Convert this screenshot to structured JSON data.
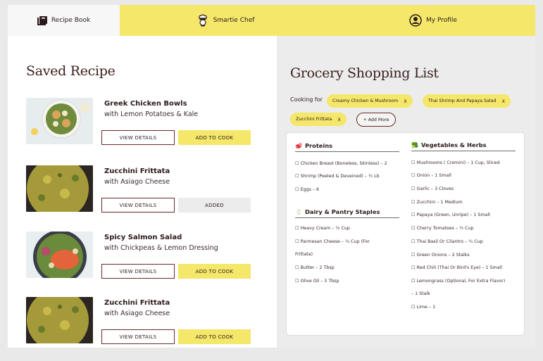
{
  "nav": {
    "tabs": [
      {
        "label": "Recipe Book",
        "icon": "book-icon"
      },
      {
        "label": "Smartie Chef",
        "icon": "chef-icon"
      },
      {
        "label": "My Profile",
        "icon": "profile-icon"
      }
    ]
  },
  "saved": {
    "title": "Saved Recipe",
    "recipes": [
      {
        "name": "Greek Chicken Bowls",
        "sub": "with Lemon Potatoes & Kale",
        "view": "VIEW DETAILS",
        "action": "ADD TO COOK"
      },
      {
        "name": "Zucchini Frittata",
        "sub": "with Asiago Cheese",
        "view": "VIEW DETAILS",
        "action": "ADDED"
      },
      {
        "name": "Spicy Salmon Salad",
        "sub": "with Chickpeas & Lemon Dressing",
        "view": "VIEW DETAILS",
        "action": "ADD TO COOK"
      },
      {
        "name": "Zucchini Frittata",
        "sub": "with Asiago Cheese",
        "view": "VIEW DETAILS",
        "action": "ADD TO COOK"
      }
    ]
  },
  "grocery": {
    "title": "Grocery Shopping List",
    "cooking_for_label": "Cooking for",
    "chips": [
      "Creamy Chicken & Mushroom",
      "Thai Shrimp And Papaya Salad",
      "Zucchini Frittata"
    ],
    "chip_close": "X",
    "add_more": "+ Add More",
    "sections": {
      "proteins": {
        "title": "Proteins",
        "items": [
          "☐ Chicken Breast (Boneless, Skinless) – 2",
          "☐ Shrimp (Peeled & Deveined) – ½ Lb",
          "☐ Eggs – 6"
        ]
      },
      "dairy": {
        "title": "Dairy & Pantry Staples",
        "items": [
          "☐ Heavy Cream – ½ Cup",
          "☐ Parmesan Cheese – ¼ Cup (For",
          "Frittata)",
          "☐ Butter – 2 Tbsp",
          "☐ Olive Oil – 3 Tbsp"
        ]
      },
      "veg": {
        "title": "Vegetables & Herbs",
        "items": [
          "☐ Mushrooms ( Cremini) – 1 Cup, Sliced",
          "☐ Onion – 1 Small",
          "☐ Garlic – 3 Cloves",
          "☐ Zucchini – 1 Medium",
          "☐ Papaya (Green, Unripe) – 1 Small",
          "☐ Cherry Tomatoes – ½ Cup",
          "☐ Thai Basil Or Cilantro – ¼ Cup",
          "☐ Green Onions – 2 Stalks",
          "☐ Red Chili (Thai Or Bird's Eye) – 1 Small",
          "☐ Lemongrass (Optional, For Extra Flavor)",
          "– 1 Stalk",
          "☐ Lime – 1"
        ]
      }
    }
  },
  "colors": {
    "accent_yellow": "#f4e76a",
    "text_dark": "#3b1e1e",
    "button_border": "#6b2a2a"
  }
}
